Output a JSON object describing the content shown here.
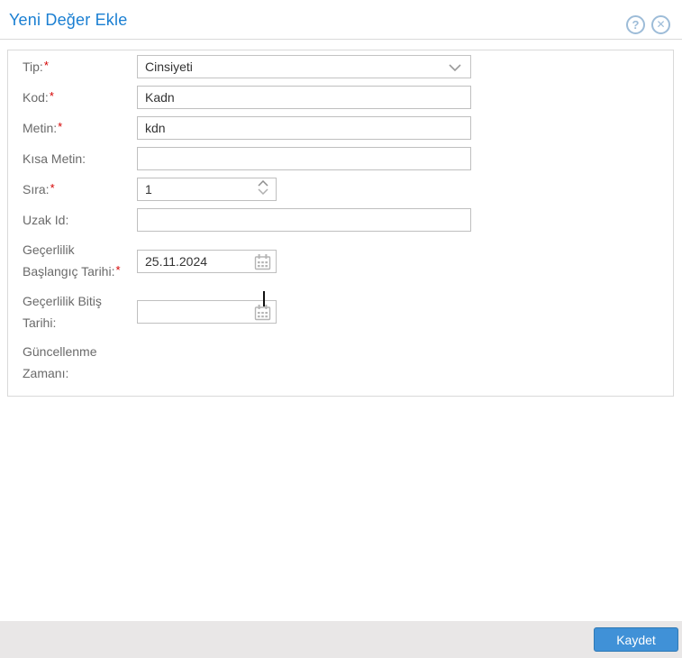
{
  "header": {
    "title": "Yeni Değer Ekle",
    "help_icon_glyph": "?",
    "close_icon_glyph": "✕"
  },
  "form": {
    "required_marker": "*",
    "fields": [
      {
        "label": "Tip:",
        "required": true,
        "type": "select",
        "value": "Cinsiyeti"
      },
      {
        "label": "Kod:",
        "required": true,
        "type": "text",
        "value": "Kadn"
      },
      {
        "label": "Metin:",
        "required": true,
        "type": "text",
        "value": "kdn"
      },
      {
        "label": "Kısa Metin:",
        "required": false,
        "type": "text",
        "value": ""
      },
      {
        "label": "Sıra:",
        "required": true,
        "type": "number",
        "value": "1"
      },
      {
        "label": "Uzak Id:",
        "required": false,
        "type": "text",
        "value": ""
      },
      {
        "label": "Geçerlilik Başlangıç Tarihi:",
        "required": true,
        "type": "date",
        "value": "25.11.2024"
      },
      {
        "label": "Geçerlilik Bitiş Tarihi:",
        "required": false,
        "type": "date",
        "value": ""
      },
      {
        "label": "Güncellenme Zamanı:",
        "required": false,
        "type": "none",
        "value": ""
      }
    ]
  },
  "icons": {
    "help": "help-icon",
    "close": "close-icon",
    "dropdown": "chevron-down-icon",
    "spinner_up": "chevron-up-icon",
    "spinner_down": "chevron-down-icon",
    "calendar": "calendar-icon"
  },
  "footer": {
    "save_label": "Kaydet"
  },
  "colors": {
    "title_blue": "#1a7fd2",
    "header_icon_blue": "#9dbcd8",
    "label_gray": "#6a6a6a",
    "required_red": "#d40000",
    "input_border": "#bfbfbf",
    "input_text": "#333333",
    "panel_border": "#d9d9d9",
    "footer_bg": "#e9e7e7",
    "button_bg": "#4091d7",
    "button_border": "#3079b5",
    "button_text": "#ffffff"
  }
}
